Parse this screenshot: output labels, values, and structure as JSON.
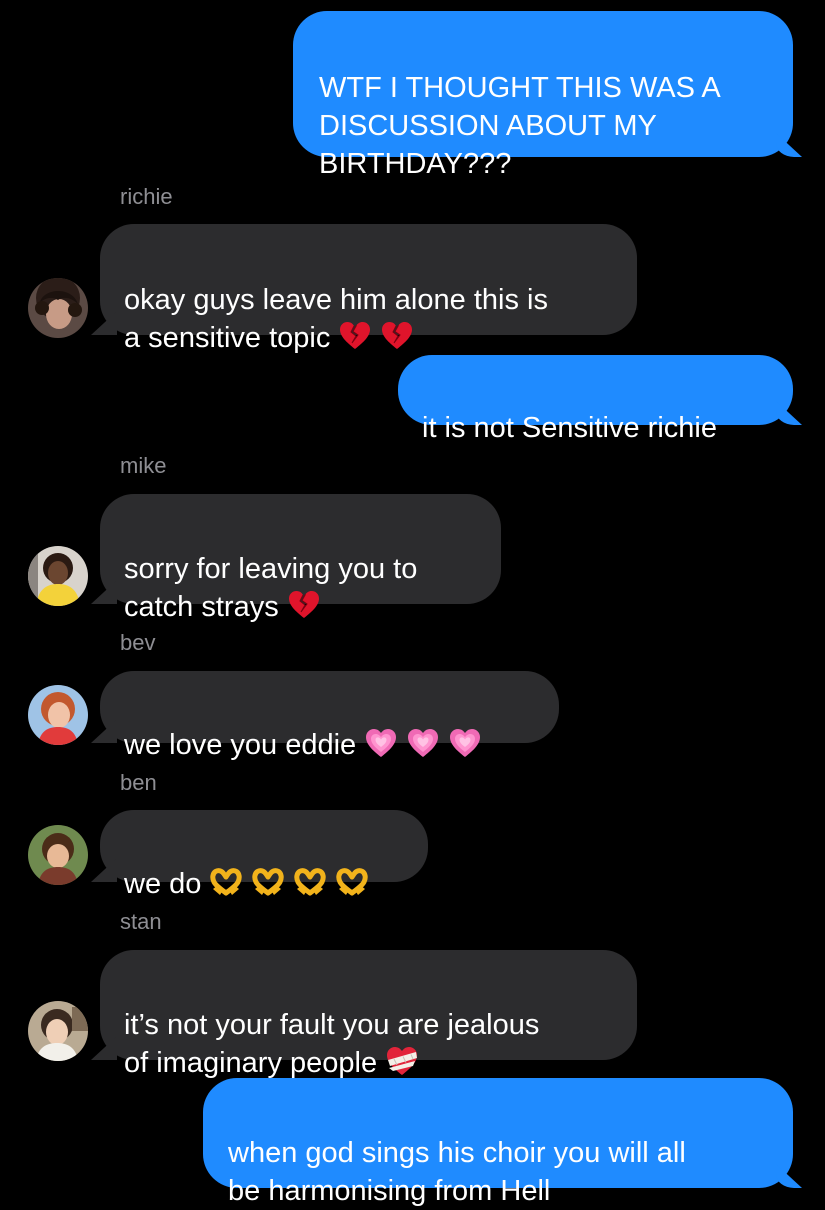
{
  "conversation": {
    "messages": [
      {
        "id": "m1",
        "direction": "outgoing",
        "text": "WTF I THOUGHT THIS WAS A\nDISCUSSION ABOUT MY\nBIRTHDAY???"
      },
      {
        "id": "m2",
        "direction": "incoming",
        "sender": "richie",
        "text": "okay guys leave him alone this is\na sensitive topic",
        "emoji": [
          "broken-heart-icon",
          "broken-heart-icon"
        ]
      },
      {
        "id": "m3",
        "direction": "outgoing",
        "text": "it is not Sensitive richie"
      },
      {
        "id": "m4",
        "direction": "incoming",
        "sender": "mike",
        "text": "sorry for leaving you to\ncatch strays",
        "emoji": [
          "broken-heart-icon"
        ]
      },
      {
        "id": "m5",
        "direction": "incoming",
        "sender": "bev",
        "text": "we love you eddie",
        "emoji": [
          "growing-heart-icon",
          "growing-heart-icon",
          "growing-heart-icon"
        ]
      },
      {
        "id": "m6",
        "direction": "incoming",
        "sender": "ben",
        "text": "we do",
        "emoji": [
          "heart-hands-icon",
          "heart-hands-icon",
          "heart-hands-icon",
          "heart-hands-icon"
        ]
      },
      {
        "id": "m7",
        "direction": "incoming",
        "sender": "stan",
        "text": "it’s not your fault you are jealous\nof imaginary people",
        "emoji": [
          "mending-heart-icon"
        ]
      },
      {
        "id": "m8",
        "direction": "outgoing",
        "text": "when god sings his choir you will all\nbe harmonising from Hell"
      }
    ]
  },
  "colors": {
    "background": "#000000",
    "outgoing_bubble": "#1f8bff",
    "incoming_bubble": "#2c2c2e",
    "sender_label": "#8e8e93",
    "text": "#ffffff"
  }
}
